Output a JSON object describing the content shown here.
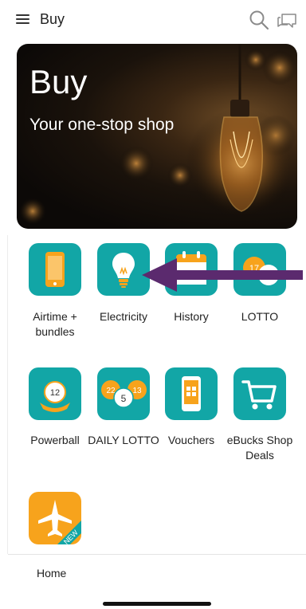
{
  "header": {
    "title": "Buy",
    "menu_icon": "hamburger-menu-icon",
    "search_icon": "search-icon",
    "chat_icon": "chat-icon"
  },
  "banner": {
    "title": "Buy",
    "subtitle": "Your one-stop shop"
  },
  "grid": {
    "items": [
      {
        "label": "Airtime + bundles",
        "icon": "phone-icon"
      },
      {
        "label": "Electricity",
        "icon": "lightbulb-icon"
      },
      {
        "label": "History",
        "icon": "calendar-icon"
      },
      {
        "label": "LOTTO",
        "icon": "lotto-ball-icon"
      },
      {
        "label": "Powerball",
        "icon": "powerball-icon"
      },
      {
        "label": "DAILY LOTTO",
        "icon": "daily-lotto-icon"
      },
      {
        "label": "Vouchers",
        "icon": "voucher-icon"
      },
      {
        "label": "eBucks Shop Deals",
        "icon": "shopping-cart-icon"
      },
      {
        "label": "",
        "icon": "travel-plane-icon"
      }
    ]
  },
  "nav": {
    "home_label": "Home"
  },
  "colors": {
    "tile_teal": "#12a6a6",
    "accent_orange": "#f7a31c",
    "arrow_purple": "#5b2a6e"
  }
}
